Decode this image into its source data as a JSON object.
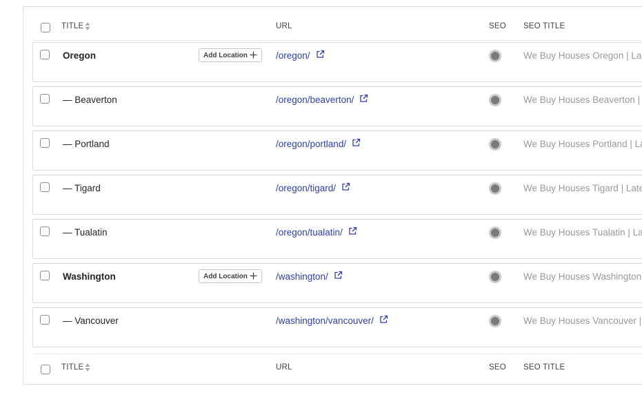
{
  "columns": {
    "title": "TITLE",
    "url": "URL",
    "seo": "SEO",
    "seo_title": "SEO TITLE"
  },
  "add_location_label": "Add Location",
  "rows": [
    {
      "title": "Oregon",
      "url": "/oregon/",
      "seo_title": "We Buy Houses Oregon | La",
      "parent": true
    },
    {
      "title": "— Beaverton",
      "url": "/oregon/beaverton/",
      "seo_title": "We Buy Houses Beaverton |",
      "parent": false
    },
    {
      "title": "— Portland",
      "url": "/oregon/portland/",
      "seo_title": "We Buy Houses Portland | La",
      "parent": false
    },
    {
      "title": "— Tigard",
      "url": "/oregon/tigard/",
      "seo_title": "We Buy Houses Tigard | Late",
      "parent": false
    },
    {
      "title": "— Tualatin",
      "url": "/oregon/tualatin/",
      "seo_title": "We Buy Houses Tualatin | La",
      "parent": false
    },
    {
      "title": "Washington",
      "url": "/washington/",
      "seo_title": "We Buy Houses Washington",
      "parent": true
    },
    {
      "title": "— Vancouver",
      "url": "/washington/vancouver/",
      "seo_title": "We Buy Houses Vancouver |",
      "parent": false
    }
  ],
  "colors": {
    "link": "#2f3fa6",
    "seo_dot": "#7a7a7a",
    "border": "#dcdcde"
  }
}
